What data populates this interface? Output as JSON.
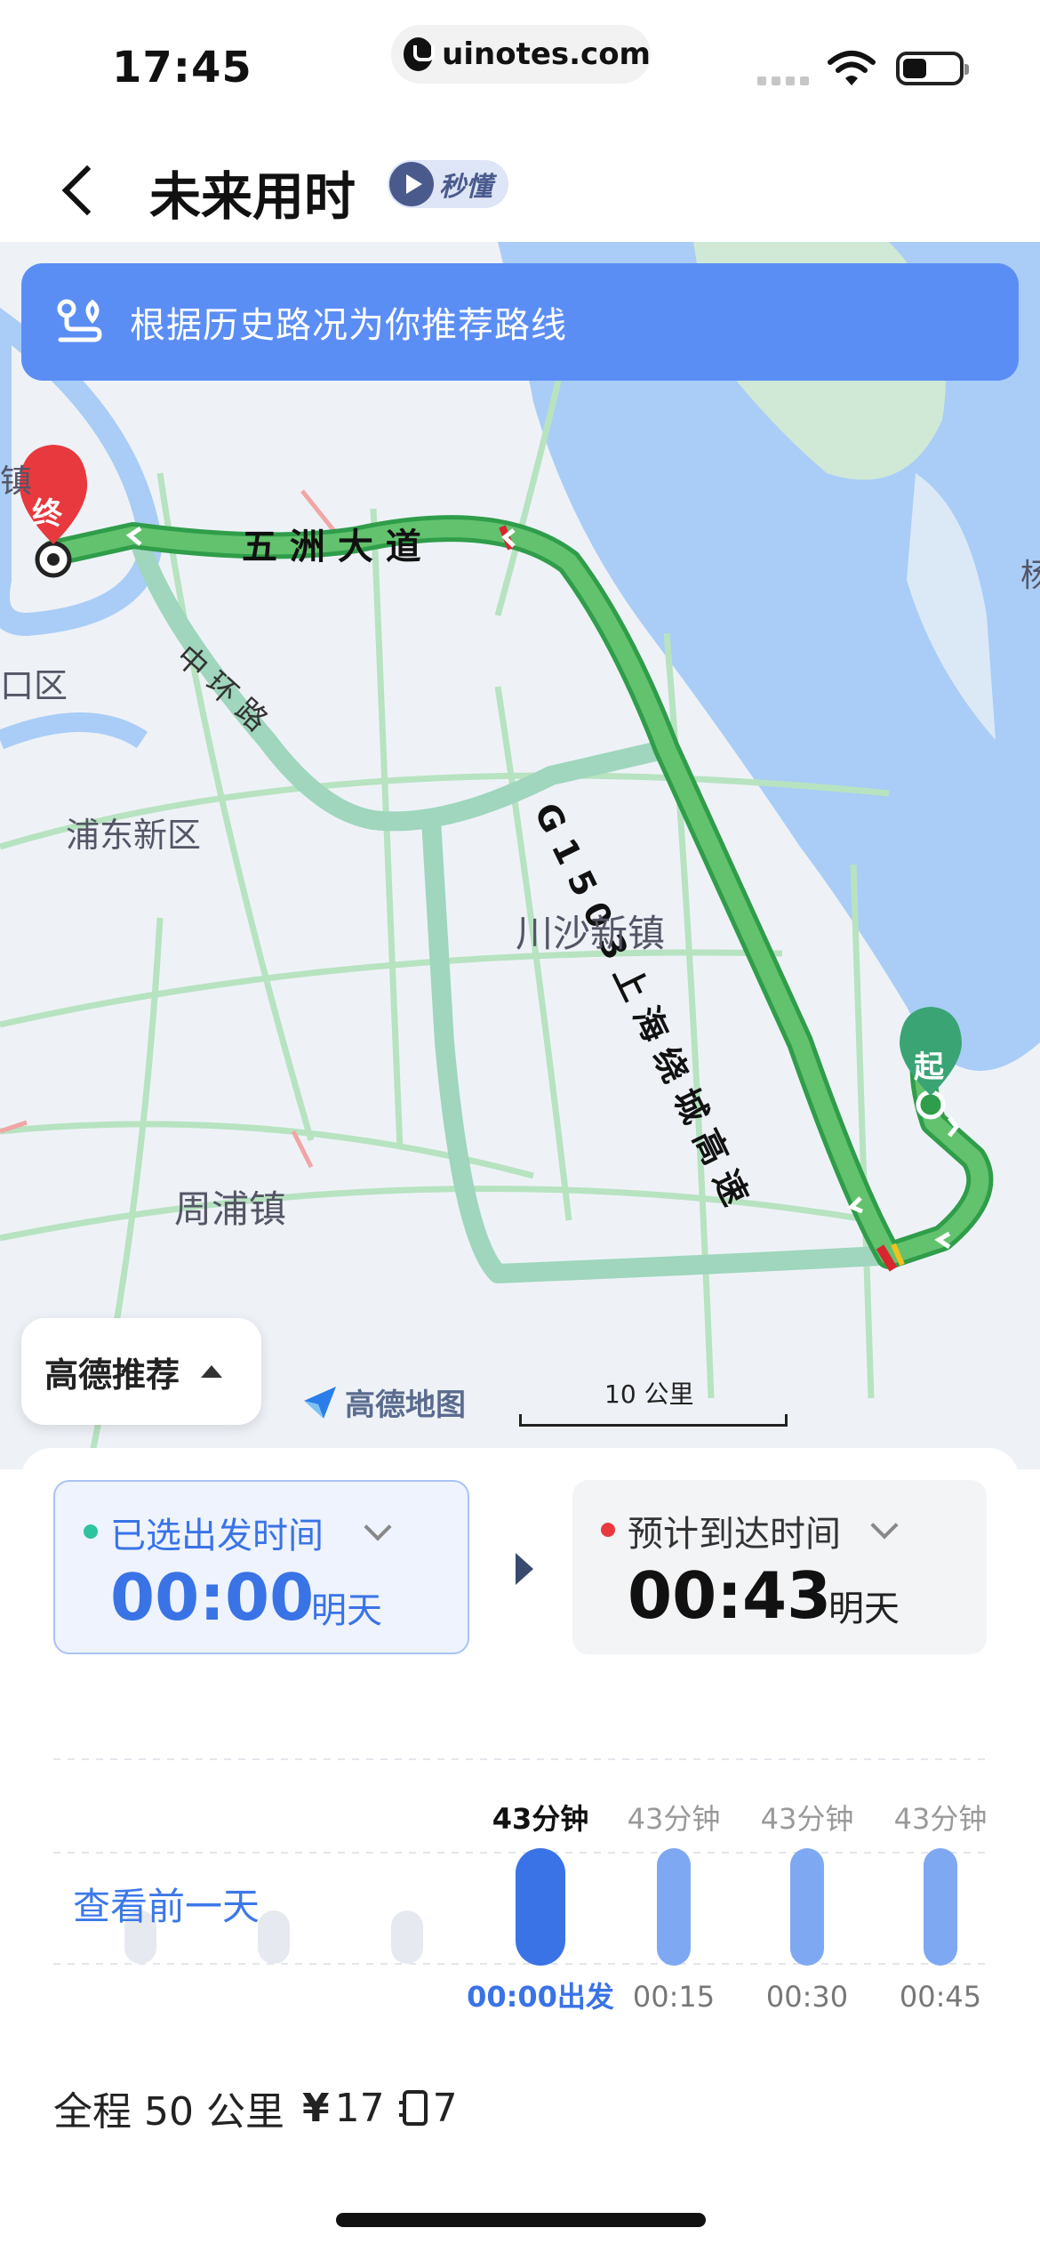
{
  "status_bar": {
    "time": "17:45",
    "url": "uinotes.com"
  },
  "nav": {
    "title": "未来用时",
    "badge_label": "秒懂"
  },
  "map": {
    "banner_text": "根据历史路况为你推荐路线",
    "labels": {
      "end_marker": "终",
      "start_marker": "起",
      "road_wuzhou": "五 洲 大 道",
      "road_g1503": "G 1 5 0 3 上 海 绕 城 高 速",
      "road_zhonghuan": "中 环 路",
      "district_pudong": "浦东新区",
      "district_kou": "口区",
      "town_chuansha": "川沙新镇",
      "town_zhoupu": "周浦镇",
      "edge_left": "镇",
      "edge_right": "杨"
    },
    "recommend_button": "高德推荐",
    "logo_text": "高德地图",
    "scale_label": "10 公里"
  },
  "panel": {
    "depart": {
      "label": "已选出发时间",
      "time": "00:00",
      "day": "明天",
      "color": "#3a73e6"
    },
    "arrive": {
      "label": "预计到达时间",
      "time": "00:43",
      "day": "明天",
      "color": "#111111"
    },
    "prev_day_link": "查看前一天",
    "summary": {
      "distance": "全程 50 公里",
      "cost": "17",
      "toll_count": "7"
    }
  },
  "chart_data": {
    "type": "bar",
    "categories": [
      "",
      "",
      "",
      "00:00出发",
      "00:15",
      "00:30",
      "00:45"
    ],
    "values": [
      null,
      null,
      null,
      43,
      43,
      43,
      43
    ],
    "value_labels": [
      "",
      "",
      "",
      "43分钟",
      "43分钟",
      "43分钟",
      "43分钟"
    ],
    "selected_index": 3,
    "colors": {
      "selected": "#3a73e6",
      "normal": "#7fa8f2",
      "placeholder": "#e6e9ef"
    },
    "ylim": [
      0,
      43
    ]
  }
}
